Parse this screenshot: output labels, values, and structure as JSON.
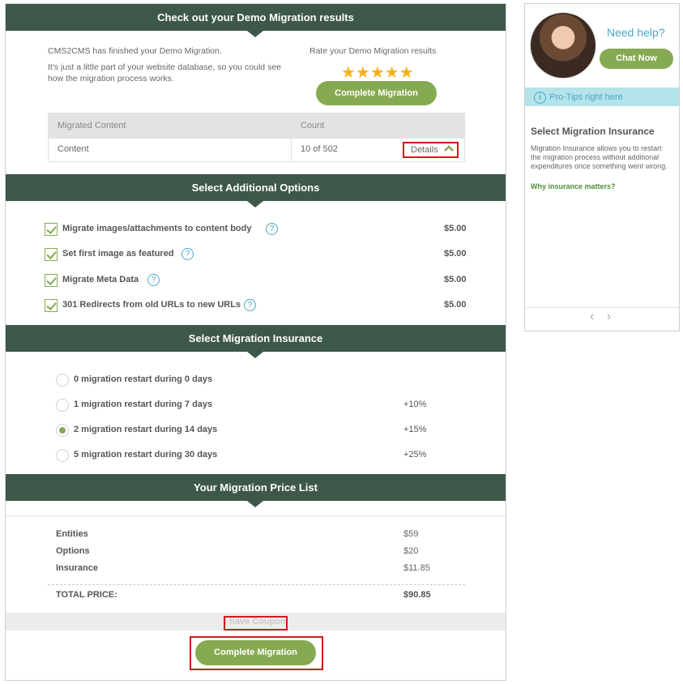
{
  "results": {
    "title": "Check out your Demo Migration results",
    "intro_line1": "CMS2CMS has finished your Demo Migration.",
    "intro_line2": "It's just a little part of your website database, so you could see how the migration process works.",
    "rate_label": "Rate your Demo Migration results",
    "stars": "★★★★★",
    "complete_button": "Complete Migration",
    "table": {
      "col_content": "Migrated Content",
      "col_count": "Count",
      "row_label": "Content",
      "row_count": "10 of 502",
      "details_label": "Details"
    }
  },
  "options": {
    "title": "Select Additional Options",
    "items": [
      {
        "label": "Migrate images/attachments to content body",
        "price": "$5.00"
      },
      {
        "label": "Set first image as featured",
        "price": "$5.00"
      },
      {
        "label": "Migrate Meta Data",
        "price": "$5.00"
      },
      {
        "label": "301 Redirects from old URLs to new URLs",
        "price": "$5.00"
      }
    ]
  },
  "insurance": {
    "title": "Select Migration Insurance",
    "items": [
      {
        "label": "0 migration restart during 0 days",
        "pct": ""
      },
      {
        "label": "1 migration restart during 7 days",
        "pct": "+10%"
      },
      {
        "label": "2 migration restart during 14 days",
        "pct": "+15%"
      },
      {
        "label": "5 migration restart during 30 days",
        "pct": "+25%"
      }
    ],
    "selected_index": 2
  },
  "price_list": {
    "title": "Your Migration Price List",
    "rows": [
      {
        "label": "Entities",
        "value": "$59"
      },
      {
        "label": "Options",
        "value": "$20"
      },
      {
        "label": "Insurance",
        "value": "$11.85"
      }
    ],
    "total_label": "TOTAL PRICE:",
    "total_value": "$90.85",
    "coupon_label": "I have Coupon",
    "complete_button": "Complete Migration"
  },
  "side": {
    "need_help": "Need help?",
    "chat_button": "Chat Now",
    "pro_tips": "Pro-Tips right here",
    "tip_title": "Select Migration Insurance",
    "tip_body": "Migration Insurance allows you to restart the migration process without additional expenditures once something went wrong.",
    "tip_link": "Why insurance matters?",
    "prev_arrow": "‹",
    "next_arrow": "›"
  },
  "colors": {
    "band": "#3d5849",
    "accent_green": "#86aa52",
    "accent_blue": "#4aa8c4",
    "highlight_red": "#d4161b",
    "star": "#f6b21b"
  }
}
